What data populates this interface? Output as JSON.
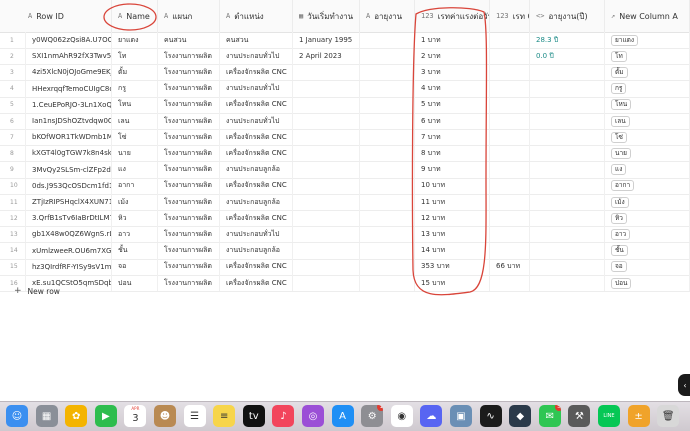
{
  "headers": [
    {
      "icon": "A",
      "label": "Row ID"
    },
    {
      "icon": "A",
      "label": "Name"
    },
    {
      "icon": "A",
      "label": "แผนก"
    },
    {
      "icon": "A",
      "label": "ตำแหน่ง"
    },
    {
      "icon": "▦",
      "label": "วันเริ่มทำงาน"
    },
    {
      "icon": "A",
      "label": "อายุงาน"
    },
    {
      "icon": "123",
      "label": "เรทค่าแรงต่อวัน"
    },
    {
      "icon": "123",
      "label": "เรท OT"
    },
    {
      "icon": "<>",
      "label": "อายุงาน(ปี)"
    },
    {
      "icon": "↗",
      "label": "New Column A"
    }
  ],
  "rows": [
    {
      "n": "1",
      "id": "y0WQ062zQsi8A.U7OO2(",
      "name": "ยาแตง",
      "dept": "คนสวน",
      "pos": "คนสวน",
      "start": "1 January 1995",
      "age": "",
      "rate": "1 บาท",
      "ot": "",
      "years": "28.3 ปี",
      "col": "ยาแตง"
    },
    {
      "n": "2",
      "id": "SXI1nmAhR92fX3Twv5OS",
      "name": "โท",
      "dept": "โรงงานการผลิต",
      "pos": "งานประกอบทั่วไป",
      "start": "2 April 2023",
      "age": "",
      "rate": "2 บาท",
      "ot": "",
      "years": "0.0 ปี",
      "col": "โท"
    },
    {
      "n": "3",
      "id": "4zi5XlcN0jOJoGme9EKJ(",
      "name": "ตั้ม",
      "dept": "โรงงานการผลิต",
      "pos": "เครื่องจักรผลิต CNC",
      "start": "",
      "age": "",
      "rate": "3 บาท",
      "ot": "",
      "years": "",
      "col": "ตั้ม"
    },
    {
      "n": "4",
      "id": "HHexrqqfTemoCUIgC8o6",
      "name": "กรู",
      "dept": "โรงงานการผลิต",
      "pos": "งานประกอบทั่วไป",
      "start": "",
      "age": "",
      "rate": "4 บาท",
      "ot": "",
      "years": "",
      "col": "กรู"
    },
    {
      "n": "5",
      "id": "1.CeuEPoRJO-3Ln1XoQB1",
      "name": "โหน",
      "dept": "โรงงานการผลิต",
      "pos": "เครื่องจักรผลิต CNC",
      "start": "",
      "age": "",
      "rate": "5 บาท",
      "ot": "",
      "years": "",
      "col": "โหน"
    },
    {
      "n": "6",
      "id": "Ian1nsJDShOZtvdqw0QvE",
      "name": "เลน",
      "dept": "โรงงานการผลิต",
      "pos": "งานประกอบทั่วไป",
      "start": "",
      "age": "",
      "rate": "6 บาท",
      "ot": "",
      "years": "",
      "col": "เลน"
    },
    {
      "n": "7",
      "id": "bKOfWOR1TkWDmb1Mb8",
      "name": "โซ่",
      "dept": "โรงงานการผลิต",
      "pos": "เครื่องจักรผลิต CNC",
      "start": "",
      "age": "",
      "rate": "7 บาท",
      "ot": "",
      "years": "",
      "col": "โซ่"
    },
    {
      "n": "8",
      "id": "kXGT4l0gTGW7k8n4sk5t",
      "name": "นาย",
      "dept": "โรงงานการผลิต",
      "pos": "เครื่องจักรผลิต CNC",
      "start": "",
      "age": "",
      "rate": "8 บาท",
      "ot": "",
      "years": "",
      "col": "นาย"
    },
    {
      "n": "9",
      "id": "3MvQy2SLSm-clZFp2dYG",
      "name": "แง",
      "dept": "โรงงานการผลิต",
      "pos": "งานประกอบลูกล้อ",
      "start": "",
      "age": "",
      "rate": "9 บาท",
      "ot": "",
      "years": "",
      "col": "แง"
    },
    {
      "n": "10",
      "id": "0ds.J9S3QcOSDcm1fd1E(",
      "name": "อากา",
      "dept": "โรงงานการผลิต",
      "pos": "เครื่องจักรผลิต CNC",
      "start": "",
      "age": "",
      "rate": "10 บาท",
      "ot": "",
      "years": "",
      "col": "อากา"
    },
    {
      "n": "11",
      "id": "ZTjIzRIPSHqclX4XUN71vC",
      "name": "เม้ง",
      "dept": "โรงงานการผลิต",
      "pos": "งานประกอบลูกล้อ",
      "start": "",
      "age": "",
      "rate": "11 บาท",
      "ot": "",
      "years": "",
      "col": "เม้ง"
    },
    {
      "n": "12",
      "id": "3.QrfB1sTv6IaBrDtILM7A",
      "name": "หิว",
      "dept": "โรงงานการผลิต",
      "pos": "เครื่องจักรผลิต CNC",
      "start": "",
      "age": "",
      "rate": "12 บาท",
      "ot": "",
      "years": "",
      "col": "หิว"
    },
    {
      "n": "13",
      "id": "gb1X48w0QZ6WgnS.rLZje",
      "name": "อาว",
      "dept": "โรงงานการผลิต",
      "pos": "งานประกอบทั่วไป",
      "start": "",
      "age": "",
      "rate": "13 บาท",
      "ot": "",
      "years": "",
      "col": "อาว"
    },
    {
      "n": "14",
      "id": "xUmlzweeR.OU6m7XGIXt",
      "name": "ชั้น",
      "dept": "โรงงานการผลิต",
      "pos": "งานประกอบลูกล้อ",
      "start": "",
      "age": "",
      "rate": "14 บาท",
      "ot": "",
      "years": "",
      "col": "ชั้น"
    },
    {
      "n": "15",
      "id": "hz3QIrdfRF-YISy9sV1m.g",
      "name": "จอ",
      "dept": "โรงงานการผลิต",
      "pos": "เครื่องจักรผลิต CNC",
      "start": "",
      "age": "",
      "rate": "353 บาท",
      "ot": "66 บาท",
      "years": "",
      "col": "จอ"
    },
    {
      "n": "16",
      "id": "xE.su1QCStO5qmSDqbItu",
      "name": "ปอน",
      "dept": "โรงงานการผลิต",
      "pos": "เครื่องจักรผลิต CNC",
      "start": "",
      "age": "",
      "rate": "15 บาท",
      "ot": "",
      "years": "",
      "col": "ปอน"
    }
  ],
  "new_row_label": "New row",
  "dock": [
    {
      "name": "finder-icon",
      "color": "#3b8ff0",
      "glyph": "☺"
    },
    {
      "name": "launchpad-icon",
      "color": "#8a8f98",
      "glyph": "▦"
    },
    {
      "name": "photos-icon",
      "color": "#f4b400",
      "glyph": "✿"
    },
    {
      "name": "facetime-icon",
      "color": "#2ebd4e",
      "glyph": "▶"
    },
    {
      "name": "calendar-icon",
      "color": "#ffffff",
      "glyph": "3",
      "label": "APR"
    },
    {
      "name": "contacts-icon",
      "color": "#b98a53",
      "glyph": "☻"
    },
    {
      "name": "reminders-icon",
      "color": "#ffffff",
      "glyph": "☰"
    },
    {
      "name": "notes-icon",
      "color": "#f7d54a",
      "glyph": "≡"
    },
    {
      "name": "appletv-icon",
      "color": "#111111",
      "glyph": "tv"
    },
    {
      "name": "music-icon",
      "color": "#f2455c",
      "glyph": "♪"
    },
    {
      "name": "podcasts-icon",
      "color": "#9b4fd6",
      "glyph": "◎"
    },
    {
      "name": "appstore-icon",
      "color": "#1f8ff5",
      "glyph": "A"
    },
    {
      "name": "settings-icon",
      "color": "#8e8e93",
      "glyph": "⚙",
      "badge": "1"
    },
    {
      "name": "chrome-icon",
      "color": "#ffffff",
      "glyph": "◉"
    },
    {
      "name": "discord-icon",
      "color": "#5865f2",
      "glyph": "☁"
    },
    {
      "name": "preview-icon",
      "color": "#6a8fb5",
      "glyph": "▣"
    },
    {
      "name": "activity-monitor-icon",
      "color": "#1b1b1b",
      "glyph": "∿"
    },
    {
      "name": "app-icon",
      "color": "#2b3a4a",
      "glyph": "◆"
    },
    {
      "name": "messages-icon",
      "color": "#2fc653",
      "glyph": "✉",
      "badge": "5"
    },
    {
      "name": "tools-icon",
      "color": "#5a5a5a",
      "glyph": "⚒"
    },
    {
      "name": "line-icon",
      "color": "#06c755",
      "glyph": "LINE"
    },
    {
      "name": "calculator-icon",
      "color": "#f0a32a",
      "glyph": "±"
    },
    {
      "name": "trash-icon",
      "color": "#d8d8d8",
      "glyph": "🗑"
    }
  ]
}
